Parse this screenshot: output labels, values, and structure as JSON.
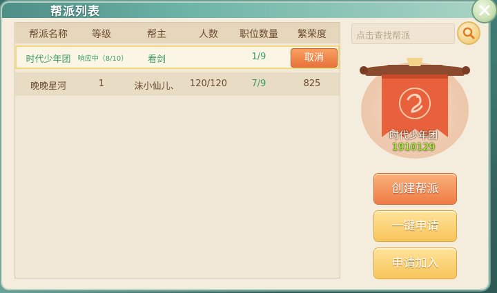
{
  "window": {
    "title": "帮派列表"
  },
  "columns": [
    "帮派名称",
    "等级",
    "帮主",
    "人数",
    "职位数量",
    "繁荣度"
  ],
  "rows": [
    {
      "name": "时代少年团",
      "level": "响应中（8/10）",
      "leader": "看剑",
      "members": "",
      "positions": "1/9",
      "prosperity": "",
      "action": "取消"
    },
    {
      "name": "晚晚星河",
      "level": "1",
      "leader": "沫小仙儿、",
      "members": "120/120",
      "positions": "7/9",
      "prosperity": "825"
    }
  ],
  "search": {
    "placeholder": "点击查找帮派"
  },
  "selected_guild": {
    "name": "时代少年团",
    "id": "1910129"
  },
  "buttons": {
    "create": "创建帮派",
    "apply_one_click": "一键申请",
    "apply_join": "申请加入"
  },
  "colors": {
    "accent_orange": "#ee7c45",
    "pending_green": "#3a9c6a",
    "id_green": "#b8ff3a"
  }
}
